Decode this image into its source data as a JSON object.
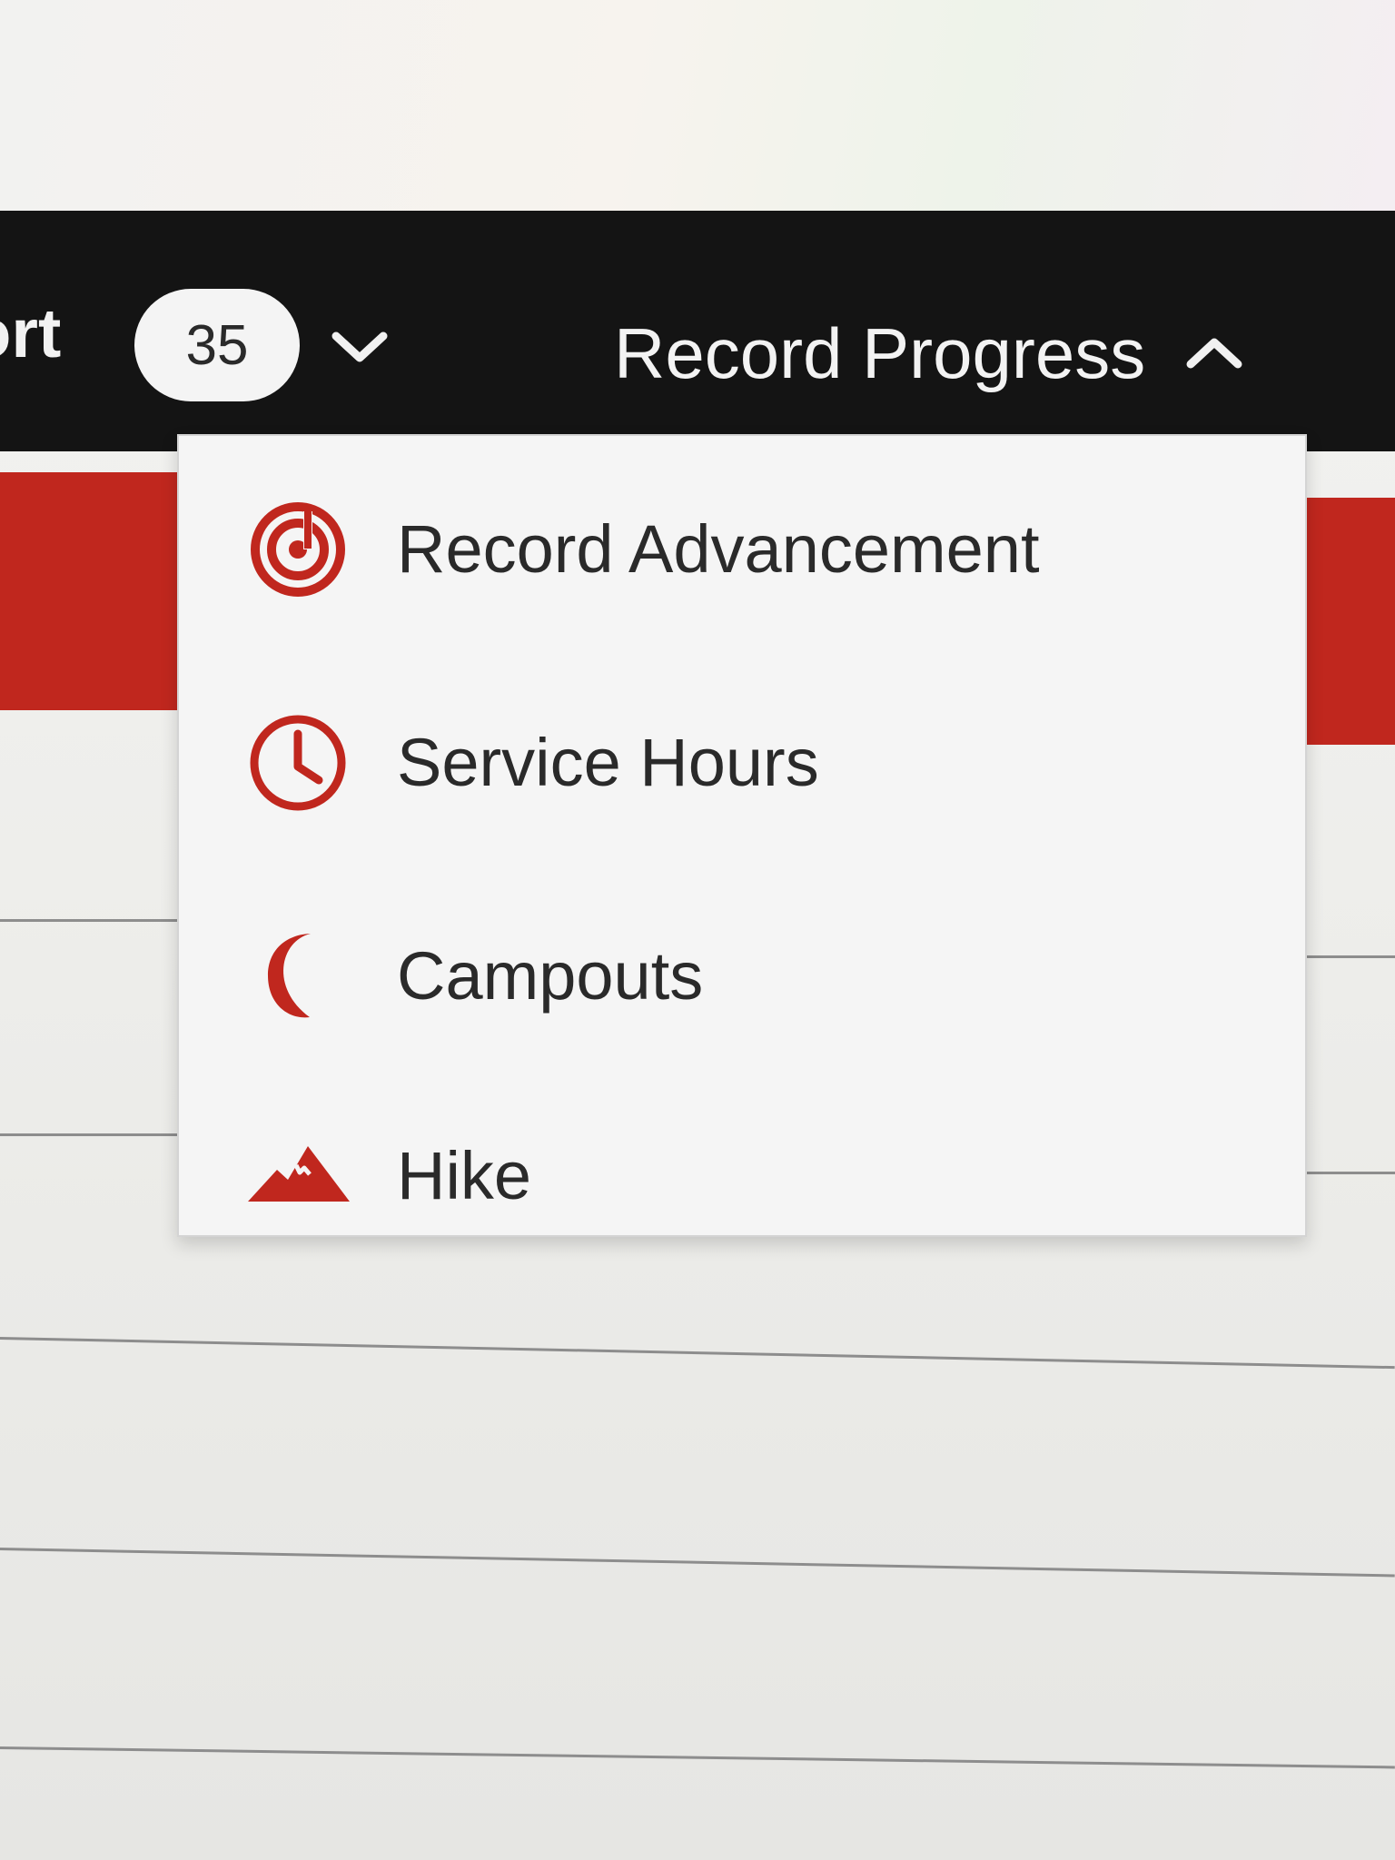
{
  "navbar": {
    "left_label": "ort",
    "count_badge": "35",
    "record_progress": {
      "label": "Record Progress",
      "expanded": true
    }
  },
  "menu": {
    "items": [
      {
        "label": "Record Advancement",
        "icon": "advancement-icon"
      },
      {
        "label": "Service Hours",
        "icon": "clock-icon"
      },
      {
        "label": "Campouts",
        "icon": "moon-icon"
      },
      {
        "label": "Hike",
        "icon": "mountain-icon"
      }
    ]
  },
  "colors": {
    "navbar": "#141414",
    "accent_red": "#c0271e",
    "menu_background": "#f5f5f5",
    "text_dark": "#2a2a2a"
  }
}
